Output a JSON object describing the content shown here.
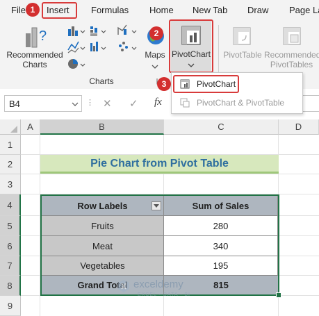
{
  "ribbon": {
    "tabs": [
      "File",
      "Insert",
      "Formulas",
      "Home",
      "New Tab",
      "Draw",
      "Page La"
    ],
    "recommended_charts": [
      "Recommended",
      "Charts"
    ],
    "maps_label": "Maps",
    "pivotchart_label": "PivotChart",
    "pivottable_label": "PivotTable",
    "recommended_pivottables": [
      "Recommended",
      "PivotTables"
    ],
    "charts_group_label": "Charts",
    "badges": [
      "1",
      "2",
      "3"
    ],
    "accent_red": "#d83b3b",
    "badge_red": "#d32f2f"
  },
  "dropdown": {
    "items": [
      "PivotChart",
      "PivotChart & PivotTable"
    ]
  },
  "formula_bar": {
    "name_box": "B4",
    "fx": "fx",
    "cancel": "✕",
    "enter": "✓"
  },
  "grid": {
    "columns": [
      "A",
      "B",
      "C",
      "D"
    ],
    "rows": [
      "1",
      "2",
      "3",
      "4",
      "5",
      "6",
      "7",
      "8",
      "9"
    ],
    "header_fill": "#aeb6bf",
    "data_fill": "#c8c8c8",
    "title_fill": "#d7e8bd",
    "title_color": "#2f6f9f"
  },
  "sheet": {
    "title": "Pie Chart from Pivot Table",
    "headers": [
      "Row Labels",
      "Sum of Sales"
    ],
    "rows": [
      {
        "label": "Fruits",
        "value": "280"
      },
      {
        "label": "Meat",
        "value": "340"
      },
      {
        "label": "Vegetables",
        "value": "195"
      }
    ],
    "total": {
      "label": "Grand Total",
      "value": "815"
    }
  },
  "watermark": {
    "name": "exceldemy",
    "tagline": "EXCEL · DATA · BI"
  }
}
